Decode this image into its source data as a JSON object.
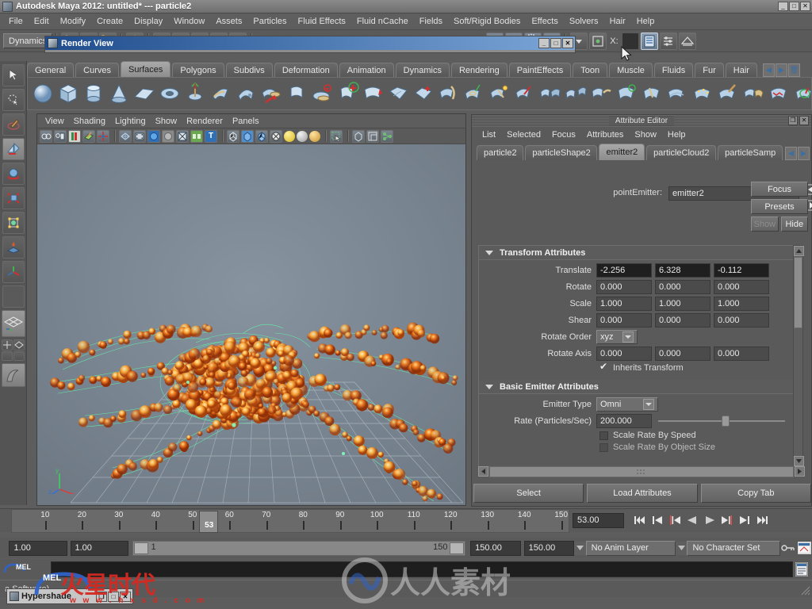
{
  "window": {
    "title": "Autodesk Maya 2012: untitled*   ---   particle2",
    "icon": "maya-icon",
    "buttons": [
      "_",
      "□",
      "✕"
    ]
  },
  "menubar": {
    "items": [
      "File",
      "Edit",
      "Modify",
      "Create",
      "Display",
      "Window",
      "Assets",
      "Particles",
      "Fluid Effects",
      "Fluid nCache",
      "Fields",
      "Soft/Rigid Bodies",
      "Effects",
      "Solvers",
      "Hair",
      "Help"
    ]
  },
  "statusbar": {
    "mode": "Dynamics",
    "x_label": "X:",
    "icons": [
      "select-by-hierarchy-icon",
      "select-by-object-icon",
      "select-by-component-icon",
      "highlight-icon",
      "snap-grid-icon",
      "snap-curve-icon",
      "snap-point-icon",
      "snap-view-plane-icon",
      "make-live-icon",
      "render-current-frame-icon",
      "ipr-render-icon",
      "render-settings-icon",
      "render-sequence-icon",
      "selection-mask-icon",
      "show-attribute-editor-icon",
      "show-channel-box-icon",
      "show-tool-settings-icon"
    ]
  },
  "shelf": {
    "tabs": [
      "General",
      "Curves",
      "Surfaces",
      "Polygons",
      "Subdivs",
      "Deformation",
      "Animation",
      "Dynamics",
      "Rendering",
      "PaintEffects",
      "Toon",
      "Muscle",
      "Fluids",
      "Fur",
      "Hair"
    ],
    "active_tab": "Surfaces",
    "nav": [
      "◀",
      "▶",
      "🗑"
    ],
    "icons": [
      "nurbs-sphere-icon",
      "nurbs-cube-icon",
      "nurbs-cylinder-icon",
      "nurbs-cone-icon",
      "nurbs-plane-icon",
      "nurbs-torus-icon",
      "nurbs-circle-icon",
      "revolve-icon",
      "loft-icon",
      "planar-icon",
      "extrude-icon",
      "birail-icon",
      "boundary-icon",
      "square-icon",
      "bevel-icon",
      "bevel-plus-icon",
      "intersect-icon",
      "project-curve-icon",
      "trim-icon",
      "untrim-icon",
      "attach-surfaces-icon",
      "detach-surfaces-icon",
      "align-surfaces-icon",
      "open-close-surfaces-icon",
      "insert-isoparm-icon",
      "offset-surface-icon",
      "rebuild-surface-icon",
      "sculpt-geometry-icon",
      "surface-fillet-icon",
      "stitch-icon",
      "sculpt-surfaces-icon"
    ]
  },
  "toolbox": {
    "items": [
      "select-tool",
      "lasso-tool",
      "paint-select-tool",
      "move-tool",
      "rotate-tool",
      "scale-tool",
      "universal-manipulator",
      "soft-modification-tool",
      "show-manipulator-tool",
      "last-tool-used",
      "four-view-layout",
      "persp-outliner-layout",
      "persp-graph-layout",
      "hotbox-layout"
    ],
    "active": "move-tool"
  },
  "viewport": {
    "menus": [
      "View",
      "Shading",
      "Lighting",
      "Show",
      "Renderer",
      "Panels"
    ],
    "icons": [
      "select-camera-icon",
      "camera-attributes-icon",
      "bookmark-icon",
      "image-plane-icon",
      "two-d-pan-zoom-icon",
      "grid-icon",
      "film-gate-icon",
      "resolution-gate-icon",
      "gate-mask-icon",
      "xray-icon",
      "xray-joints-icon",
      "text-icon",
      "wireframe-icon",
      "smooth-shade-icon",
      "shaded-wireframe-icon",
      "texture-icon",
      "light-none-icon",
      "light-default-icon",
      "light-all-icon",
      "isolate-select-icon",
      "shadows-icon",
      "screen-capture-icon",
      "playblast-icon"
    ],
    "axis": {
      "y": "y",
      "x": "x",
      "z": "z"
    }
  },
  "attribute_editor": {
    "panel_title": "Attribute Editor",
    "panel_buttons": [
      "❐",
      "✕"
    ],
    "menus": [
      "List",
      "Selected",
      "Focus",
      "Attributes",
      "Show",
      "Help"
    ],
    "tabs": [
      "particle2",
      "particleShape2",
      "emitter2",
      "particleCloud2",
      "particleSamp"
    ],
    "active_tab": "emitter2",
    "node": {
      "label": "pointEmitter:",
      "value": "emitter2"
    },
    "side_buttons": [
      "Focus",
      "Presets",
      "Show",
      "Hide"
    ],
    "sections": [
      {
        "title": "Transform Attributes",
        "rows": [
          {
            "label": "Translate",
            "values": [
              "-2.256",
              "6.328",
              "-0.112"
            ],
            "highlight": true
          },
          {
            "label": "Rotate",
            "values": [
              "0.000",
              "0.000",
              "0.000"
            ],
            "highlight": false
          },
          {
            "label": "Scale",
            "values": [
              "1.000",
              "1.000",
              "1.000"
            ],
            "highlight": false
          },
          {
            "label": "Shear",
            "values": [
              "0.000",
              "0.000",
              "0.000"
            ],
            "highlight": false
          }
        ],
        "rotate_order": {
          "label": "Rotate Order",
          "value": "xyz"
        },
        "rotate_axis": {
          "label": "Rotate Axis",
          "values": [
            "0.000",
            "0.000",
            "0.000"
          ]
        },
        "inherits": {
          "label": "Inherits Transform",
          "checked": true
        }
      },
      {
        "title": "Basic Emitter Attributes",
        "emitter_type": {
          "label": "Emitter Type",
          "value": "Omni"
        },
        "rate": {
          "label": "Rate (Particles/Sec)",
          "value": "200.000",
          "slider_pct": 50
        },
        "checks": [
          {
            "label": "Scale Rate By Speed",
            "checked": false
          },
          {
            "label": "Scale Rate By Object Size",
            "checked": false
          }
        ]
      }
    ],
    "bottom_buttons": [
      "Select",
      "Load Attributes",
      "Copy Tab"
    ]
  },
  "timeline": {
    "ticks": [
      10,
      20,
      30,
      40,
      50,
      60,
      70,
      80,
      90,
      100,
      110,
      120,
      130,
      140,
      150
    ],
    "current_frame_marker": "53",
    "current_frame_field": "53.00",
    "playback_buttons": [
      "go-to-start-icon",
      "step-back-key-icon",
      "step-back-frame-icon",
      "play-backwards-icon",
      "play-forwards-icon",
      "step-forward-frame-icon",
      "step-forward-key-icon",
      "go-to-end-icon"
    ]
  },
  "rangebar": {
    "start_field": "1.00",
    "playback_start_field": "1.00",
    "range_start": "1",
    "range_end": "150",
    "playback_end_field": "150.00",
    "end_field": "150.00",
    "anim_layer": "No Anim Layer",
    "character_set": "No Character Set",
    "icons": [
      "auto-key-icon",
      "animation-preferences-icon"
    ]
  },
  "commandline": {
    "label": "MEL",
    "input_value": "",
    "script_editor_icon": "script-editor-icon"
  },
  "helpline": {
    "text": "a Software)"
  },
  "floating_windows": [
    {
      "title": "Render View",
      "icon": "render-view-icon",
      "buttons": [
        "_",
        "□",
        "✕"
      ]
    },
    {
      "title": "Hypershade",
      "icon": "hypershade-icon",
      "buttons": [
        "❐",
        "□",
        "✕"
      ]
    }
  ],
  "watermarks": {
    "brand_cn": "火星时代",
    "brand_url": "www.hxsd.com",
    "brand_mel": "MEL",
    "site_cn": "人人素材"
  },
  "colors": {
    "chrome": "#5a5a5a",
    "accent_blue": "#1f4c8c",
    "field_dark": "#1f1f1f",
    "highlight_tab": "#a8a8a8",
    "particle_orange": "#e8601c",
    "particle_green": "#5ff2a8"
  }
}
